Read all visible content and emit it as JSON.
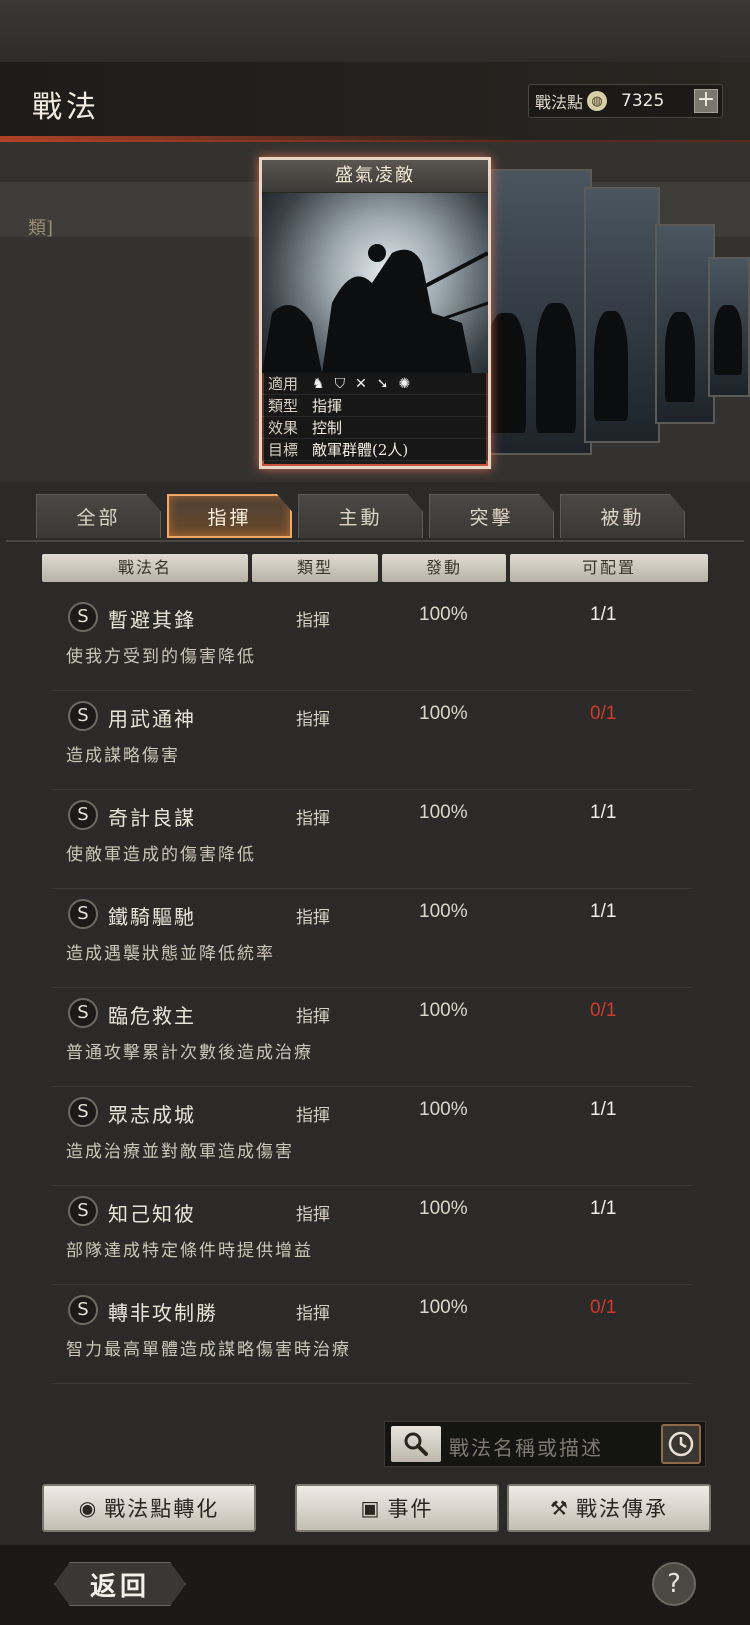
{
  "header": {
    "title": "戰法",
    "points_label": "戰法點",
    "points_value": "7325",
    "plus_icon": "plus-icon"
  },
  "side_fragment": "類]",
  "card": {
    "name": "盛氣凌敵",
    "rows": [
      {
        "key": "適用",
        "value": ""
      },
      {
        "key": "類型",
        "value": "指揮"
      },
      {
        "key": "效果",
        "value": "控制"
      },
      {
        "key": "目標",
        "value": "敵軍群體(2人)"
      }
    ],
    "unit_icons": [
      "cavalry-icon",
      "shield-icon",
      "bow-icon",
      "spear-icon",
      "wheel-icon"
    ]
  },
  "tabs": [
    {
      "label": "全部",
      "active": false
    },
    {
      "label": "指揮",
      "active": true
    },
    {
      "label": "主動",
      "active": false
    },
    {
      "label": "突擊",
      "active": false
    },
    {
      "label": "被動",
      "active": false
    }
  ],
  "columns": [
    "戰法名",
    "類型",
    "發動",
    "可配置"
  ],
  "skills": [
    {
      "grade": "S",
      "name": "暫避其鋒",
      "type": "指揮",
      "rate": "100%",
      "count": "1/1",
      "count_color": "#f2eee6",
      "desc": "使我方受到的傷害降低"
    },
    {
      "grade": "S",
      "name": "用武通神",
      "type": "指揮",
      "rate": "100%",
      "count": "0/1",
      "count_color": "#d0392e",
      "desc": "造成謀略傷害"
    },
    {
      "grade": "S",
      "name": "奇計良謀",
      "type": "指揮",
      "rate": "100%",
      "count": "1/1",
      "count_color": "#f2eee6",
      "desc": "使敵軍造成的傷害降低"
    },
    {
      "grade": "S",
      "name": "鐵騎驅馳",
      "type": "指揮",
      "rate": "100%",
      "count": "1/1",
      "count_color": "#f2eee6",
      "desc": "造成遇襲狀態並降低統率"
    },
    {
      "grade": "S",
      "name": "臨危救主",
      "type": "指揮",
      "rate": "100%",
      "count": "0/1",
      "count_color": "#d0392e",
      "desc": "普通攻擊累計次數後造成治療"
    },
    {
      "grade": "S",
      "name": "眾志成城",
      "type": "指揮",
      "rate": "100%",
      "count": "1/1",
      "count_color": "#f2eee6",
      "desc": "造成治療並對敵軍造成傷害"
    },
    {
      "grade": "S",
      "name": "知己知彼",
      "type": "指揮",
      "rate": "100%",
      "count": "1/1",
      "count_color": "#f2eee6",
      "desc": "部隊達成特定條件時提供增益"
    },
    {
      "grade": "S",
      "name": "轉非攻制勝",
      "type": "指揮",
      "rate": "100%",
      "count": "0/1",
      "count_color": "#d0392e",
      "desc": "智力最高單體造成謀略傷害時治療"
    }
  ],
  "search": {
    "placeholder": "戰法名稱或描述",
    "search_icon": "magnifier-icon",
    "history_icon": "clock-icon"
  },
  "actions": [
    {
      "label": "戰法點轉化",
      "icon": "drop-icon"
    },
    {
      "label": "事件",
      "icon": "alert-icon"
    },
    {
      "label": "戰法傳承",
      "icon": "hammer-icon"
    }
  ],
  "footer": {
    "back_label": "返回",
    "help_label": "?"
  }
}
